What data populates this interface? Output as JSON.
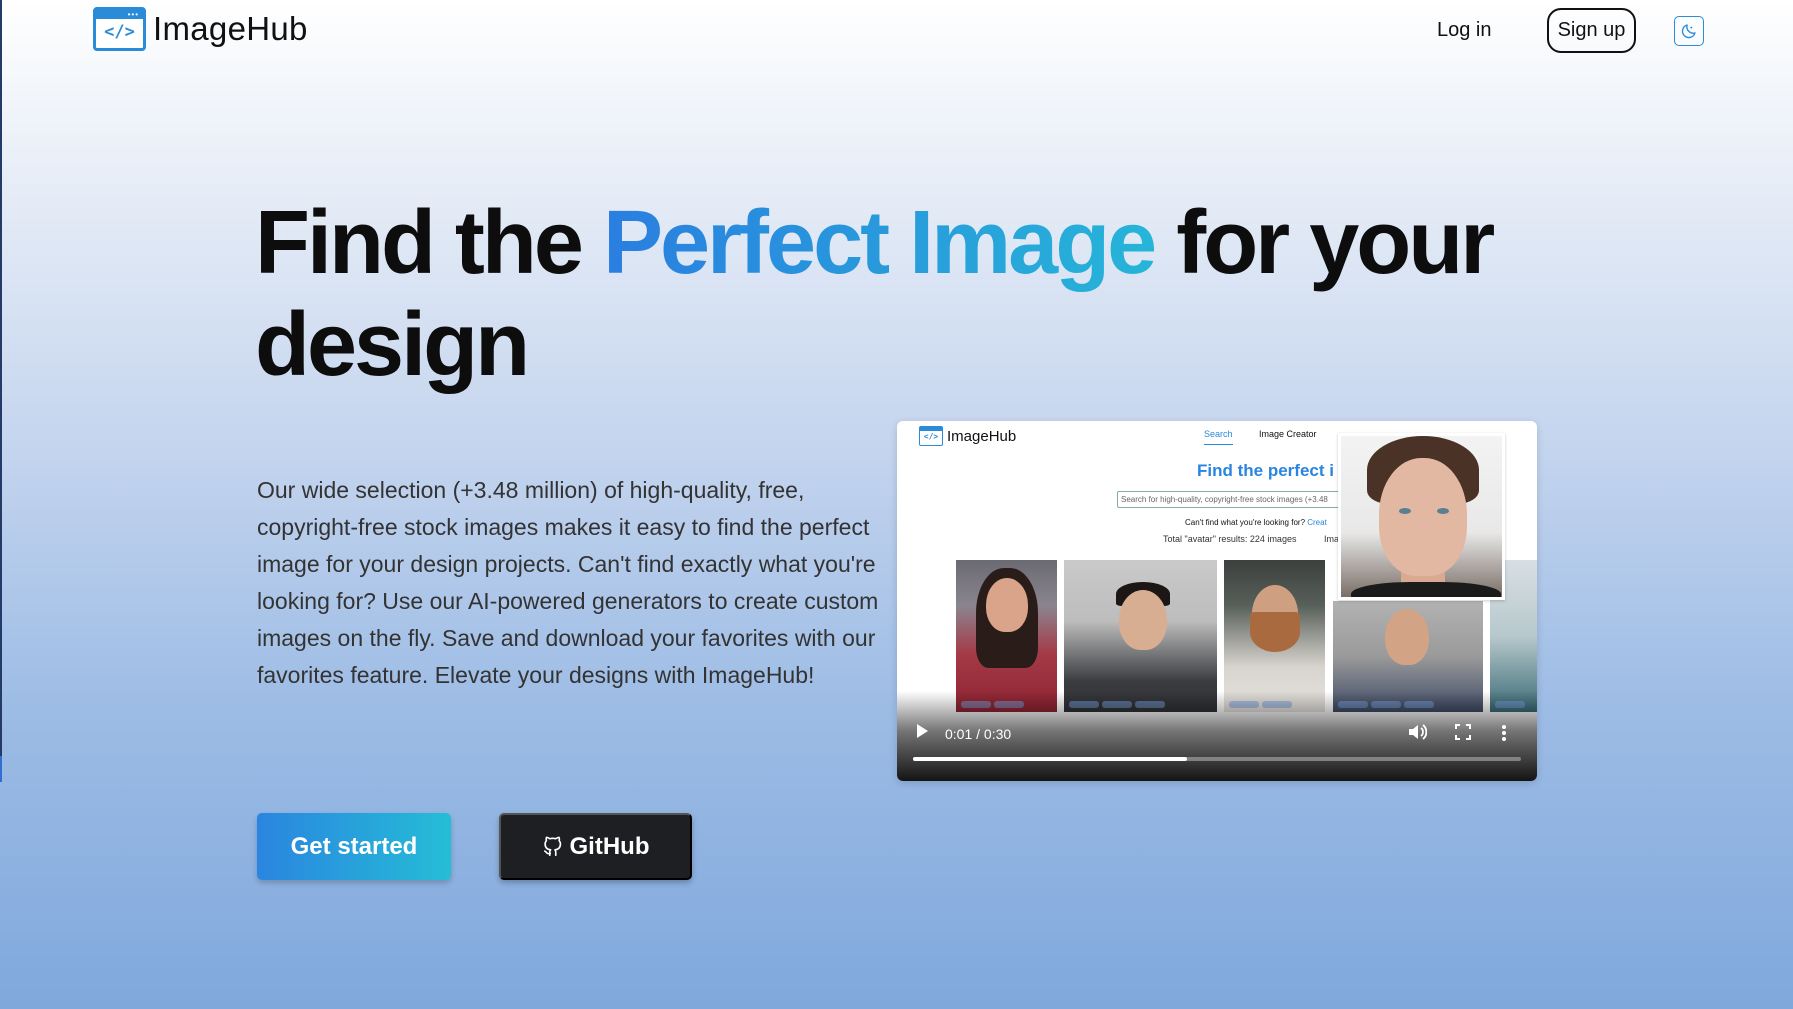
{
  "nav": {
    "brand": "ImageHub",
    "logo_glyph": "</>",
    "login": "Log in",
    "signup": "Sign up",
    "theme_icon": "moon-icon"
  },
  "hero": {
    "headline_pre": "Find the ",
    "headline_highlight": "Perfect Image",
    "headline_post": " for your design",
    "description": "Our wide selection (+3.48 million) of high-quality, free, copyright-free stock images makes it easy to find the perfect image for your design projects. Can't find exactly what you're looking for? Use our AI-powered generators to create custom images on the fly. Save and download your favorites with our favorites feature. Elevate your designs with ImageHub!",
    "get_started": "Get started",
    "github": "GitHub"
  },
  "video": {
    "app_name": "ImageHub",
    "tab_search": "Search",
    "tab_creator": "Image Creator",
    "title": "Find the perfect i",
    "search_placeholder": "Search for high-quality, copyright-free stock images (+3.48",
    "cant_find": "Can't find what you're looking for? ",
    "cant_find_link": "Creat",
    "results": "Total \"avatar\" results: 224 images",
    "results_tail": "Ima",
    "time": "0:01 / 0:30",
    "progress": 0.45,
    "colors": {
      "accent": "#2a85e0"
    }
  },
  "colors": {
    "accent_start": "#2a85e0",
    "accent_end": "#25bdd6",
    "github_bg": "#1e1f22"
  }
}
